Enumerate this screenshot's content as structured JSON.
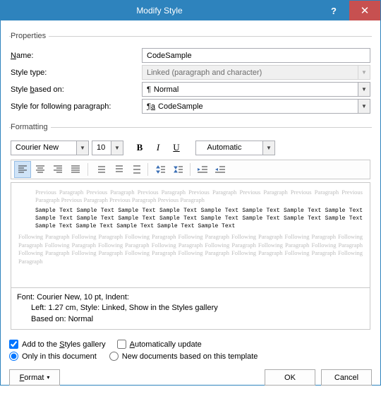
{
  "titlebar": {
    "title": "Modify Style"
  },
  "sections": {
    "properties": "Properties",
    "formatting": "Formatting"
  },
  "props": {
    "name_label_pre": "",
    "name_ul": "N",
    "name_label_post": "ame:",
    "name_value": "CodeSample",
    "type_label": "Style type:",
    "type_value": "Linked (paragraph and character)",
    "based_label_pre": "Style ",
    "based_ul": "b",
    "based_label_post": "ased on:",
    "based_value": "Normal",
    "following_label": "Style for following paragraph:",
    "following_value": "CodeSample"
  },
  "format": {
    "font": "Courier New",
    "size": "10",
    "color": "Automatic"
  },
  "preview": {
    "prev": "Previous Paragraph Previous Paragraph Previous Paragraph Previous Paragraph Previous Paragraph Previous Paragraph Previous Paragraph Previous Paragraph Previous Paragraph Previous Paragraph",
    "sample": "Sample Text Sample Text Sample Text Sample Text Sample Text Sample Text Sample Text Sample Text Sample Text Sample Text Sample Text Sample Text Sample Text Sample Text Sample Text Sample Text Sample Text Sample Text Sample Text Sample Text Sample Text",
    "next": "Following Paragraph Following Paragraph Following Paragraph Following Paragraph Following Paragraph Following Paragraph Following Paragraph Following Paragraph Following Paragraph Following Paragraph Following Paragraph Following Paragraph Following Paragraph Following Paragraph Following Paragraph Following Paragraph Following Paragraph Following Paragraph Following Paragraph Following Paragraph"
  },
  "desc": {
    "line1": "Font: Courier New, 10 pt, Indent:",
    "line2": "Left:  1.27 cm, Style: Linked, Show in the Styles gallery",
    "line3": "Based on: Normal"
  },
  "checks": {
    "add_pre": "Add to the ",
    "add_ul": "S",
    "add_post": "tyles gallery",
    "auto_ul": "A",
    "auto_post": "utomatically update"
  },
  "radios": {
    "only": "Only in this document",
    "newdocs": "New documents based on this template"
  },
  "buttons": {
    "format": "Format",
    "ok": "OK",
    "cancel": "Cancel"
  }
}
